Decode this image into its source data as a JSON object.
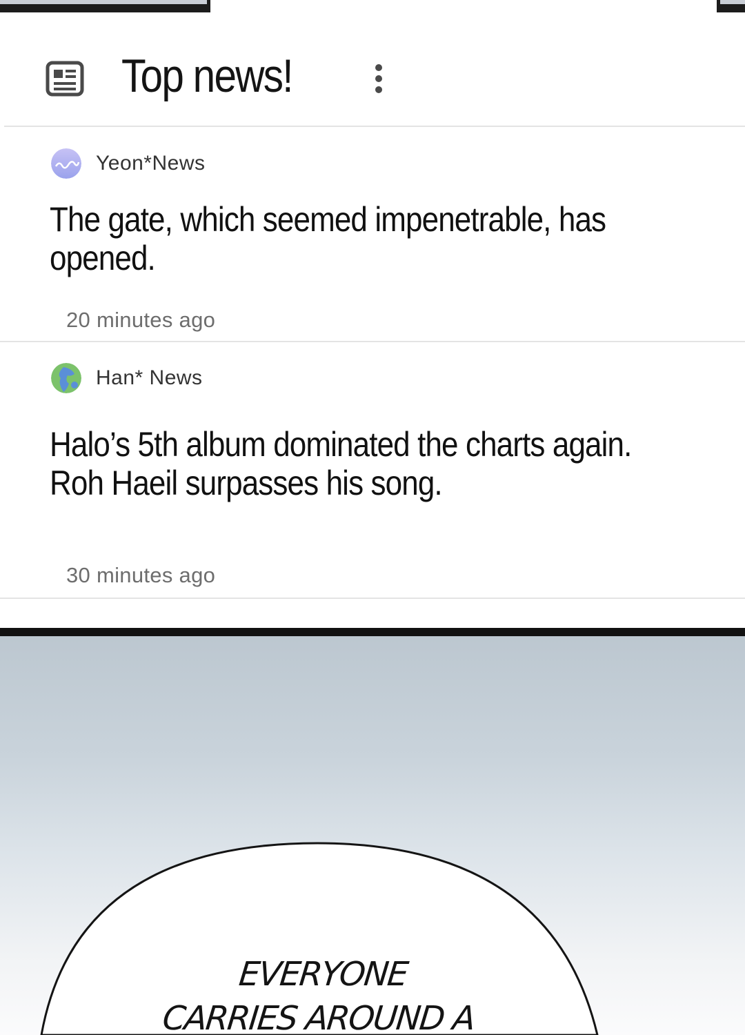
{
  "header": {
    "title": "Top news!",
    "icon": "newspaper-icon",
    "menu_icon": "more-vertical-icon"
  },
  "articles": [
    {
      "source": "Yeon*News",
      "avatar_icon": "wave-logo-icon",
      "headline": "The gate, which seemed impenetrable, has\nopened.",
      "time": "20 minutes ago"
    },
    {
      "source": "Han* News",
      "avatar_icon": "globe-logo-icon",
      "headline": "Halo’s 5th album dominated the charts again.\nRoh Haeil surpasses his song.",
      "time": "30 minutes ago"
    }
  ],
  "speech_bubble": {
    "text": "EVERYONE\nCARRIES AROUND A"
  },
  "colors": {
    "panel_border": "#111111",
    "sky_top": "#bcc7d0",
    "yeon_avatar": "#a9a6ee",
    "han_avatar": "#6cc06a"
  }
}
